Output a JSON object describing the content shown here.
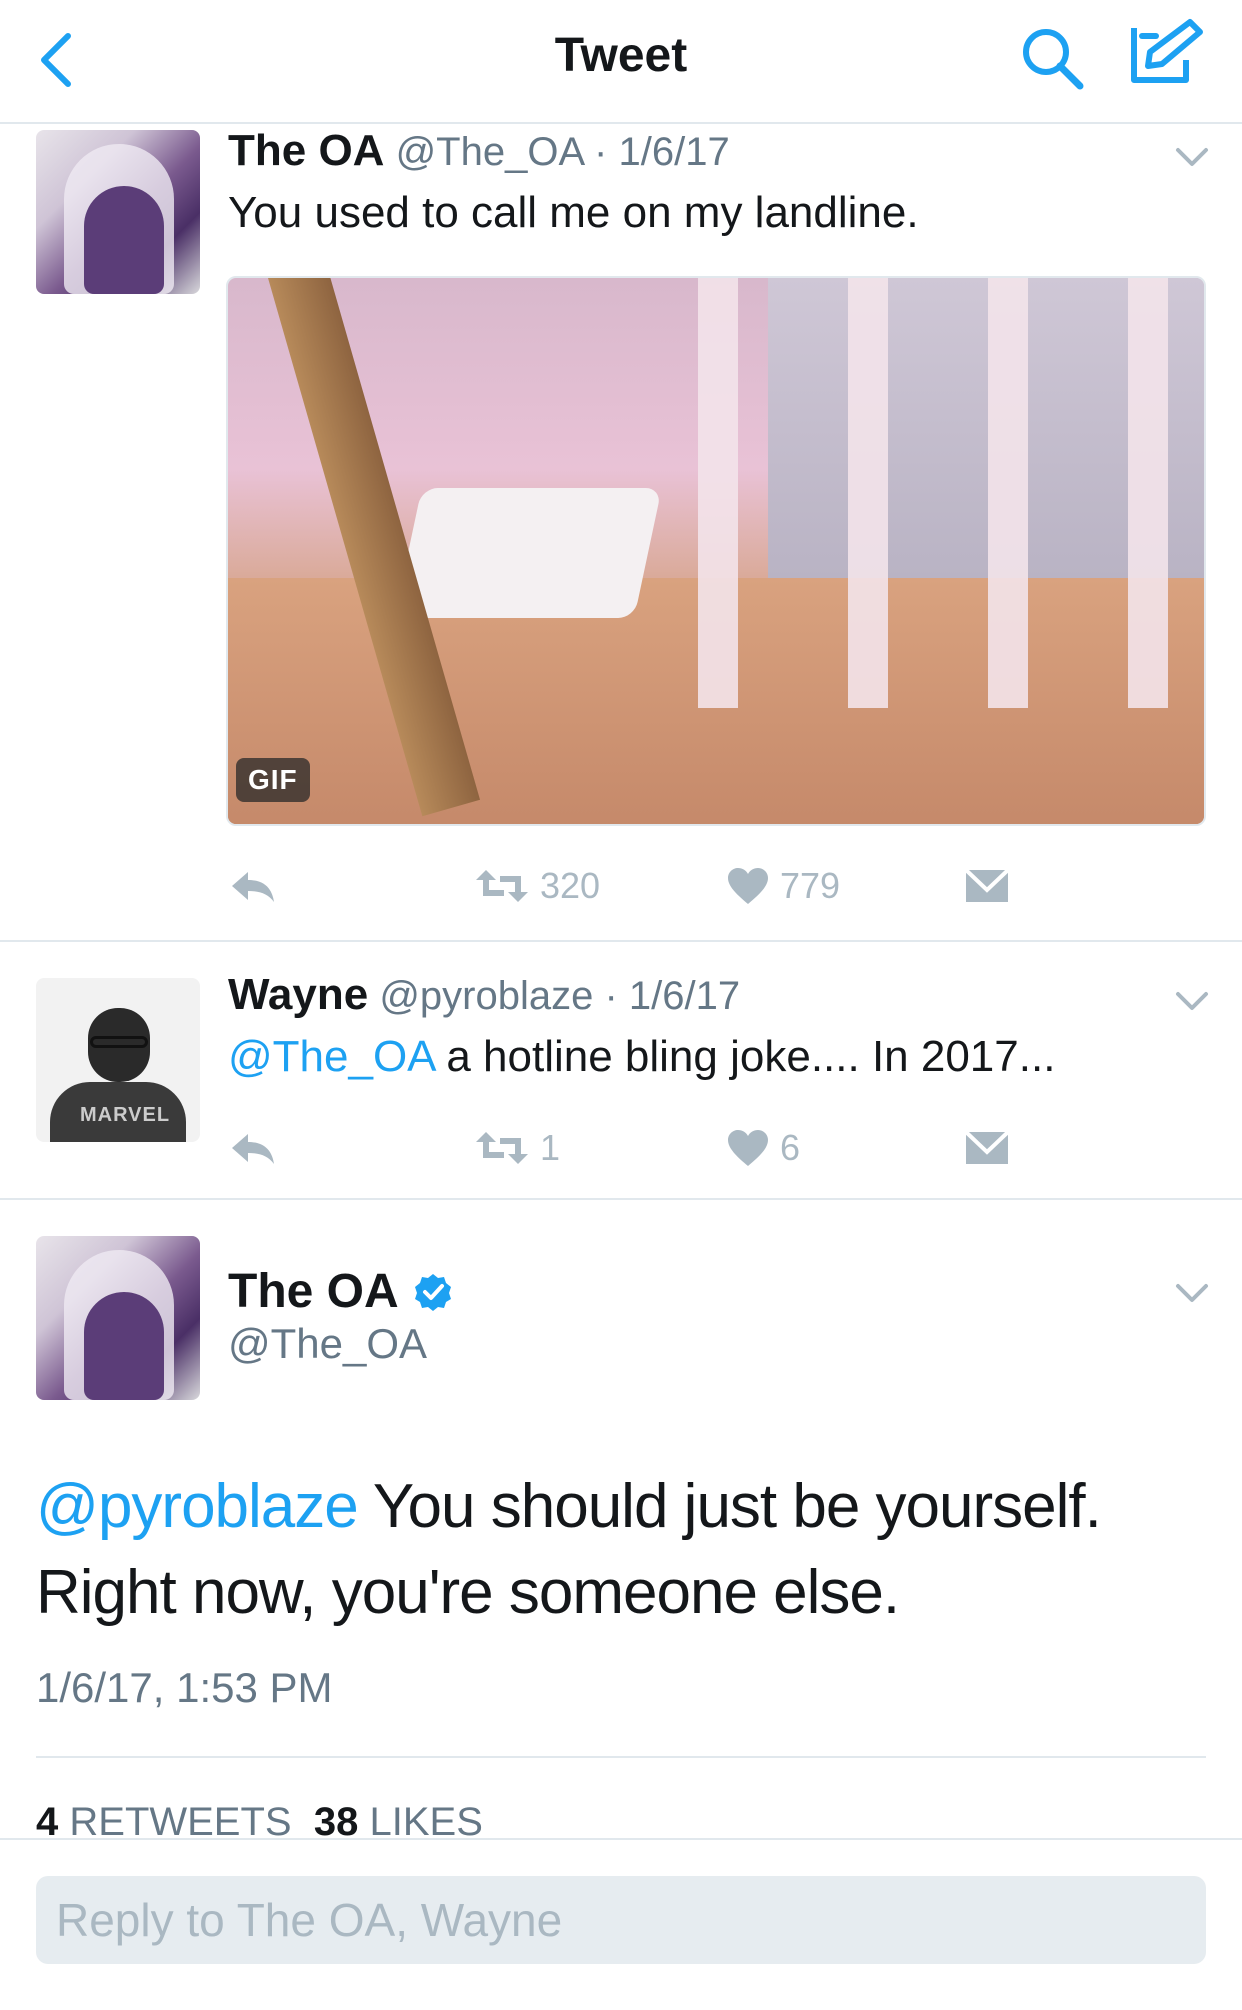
{
  "nav": {
    "title": "Tweet",
    "back_icon": "chevron-left-icon",
    "search_icon": "search-icon",
    "compose_icon": "compose-icon",
    "accent": "#1da1f2"
  },
  "thread": [
    {
      "name": "The OA",
      "handle_date": "@The_OA · 1/6/17",
      "text": "You used to call me on my landline.",
      "media_badge": "GIF",
      "retweets": "320",
      "likes": "779"
    },
    {
      "name": "Wayne",
      "handle_date": "@pyroblaze · 1/6/17",
      "mention": "@The_OA",
      "text": " a hotline bling joke.... In 2017...",
      "retweets": "1",
      "likes": "6"
    }
  ],
  "detail": {
    "name": "The OA",
    "handle": "@The_OA",
    "mention": "@pyroblaze",
    "text_line1": " You should just be yourself.",
    "text_line2": "Right now, you're someone else.",
    "timestamp": "1/6/17, 1:53 PM",
    "retweet_count": "4",
    "retweet_label": "RETWEETS",
    "like_count": "38",
    "like_label": "LIKES"
  },
  "composer": {
    "placeholder": "Reply to The OA, Wayne"
  }
}
